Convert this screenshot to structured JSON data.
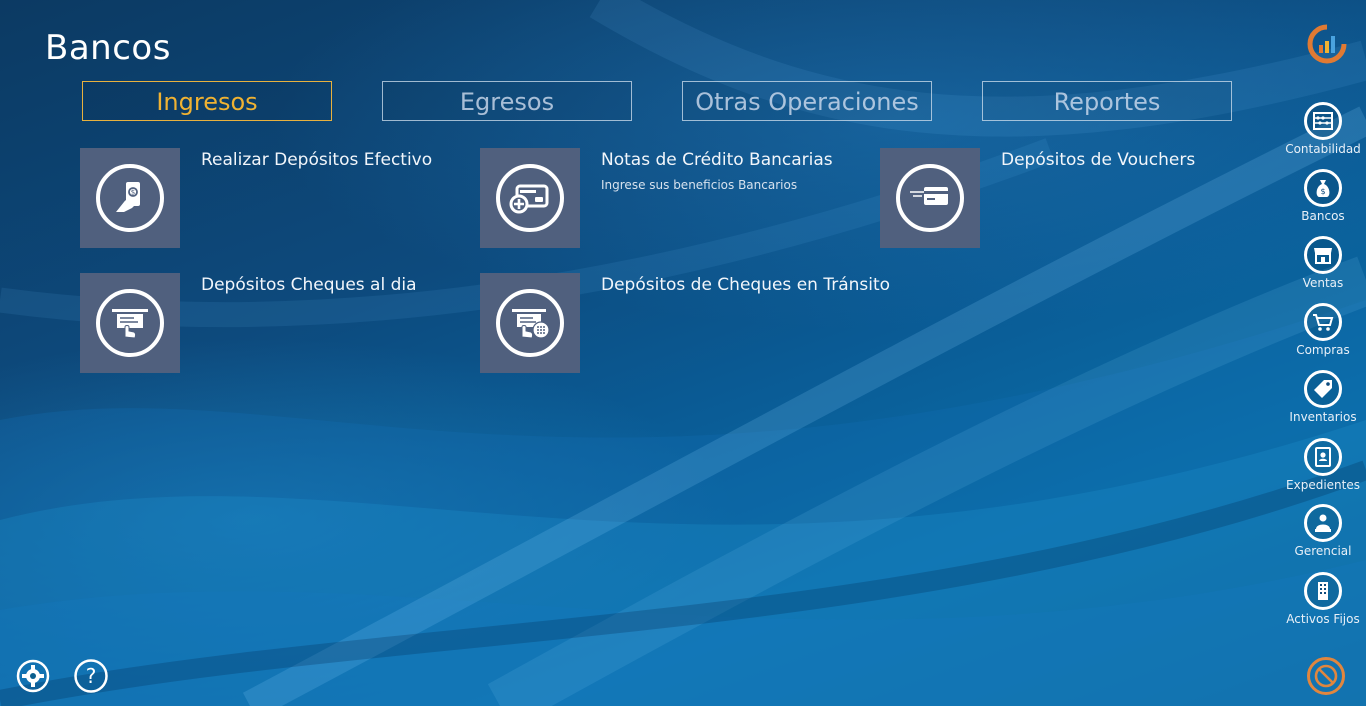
{
  "page_title": "Bancos",
  "tabs": [
    {
      "label": "Ingresos",
      "active": true
    },
    {
      "label": "Egresos",
      "active": false
    },
    {
      "label": "Otras Operaciones",
      "active": false
    },
    {
      "label": "Reportes",
      "active": false
    }
  ],
  "tiles": [
    {
      "title": "Realizar Depósitos Efectivo",
      "subtitle": "",
      "icon": "cash-hand-icon"
    },
    {
      "title": "Notas de Crédito Bancarias",
      "subtitle": "Ingrese sus beneficios Bancarios",
      "icon": "credit-card-plus-icon"
    },
    {
      "title": "Depósitos de Vouchers",
      "subtitle": "",
      "icon": "voucher-card-icon"
    },
    {
      "title": "Depósitos Cheques al dia",
      "subtitle": "",
      "icon": "check-deposit-icon"
    },
    {
      "title": "Depósitos de Cheques en Tránsito",
      "subtitle": "",
      "icon": "check-transit-icon"
    }
  ],
  "sidebar": [
    {
      "label": "Contabilidad",
      "icon": "abacus-icon"
    },
    {
      "label": "Bancos",
      "icon": "money-bag-icon"
    },
    {
      "label": "Ventas",
      "icon": "store-icon"
    },
    {
      "label": "Compras",
      "icon": "cart-icon"
    },
    {
      "label": "Inventarios",
      "icon": "tag-icon"
    },
    {
      "label": "Expedientes",
      "icon": "id-badge-icon"
    },
    {
      "label": "Gerencial",
      "icon": "manager-icon"
    },
    {
      "label": "Activos Fijos",
      "icon": "building-icon"
    }
  ],
  "icons": {
    "logo": "app-logo-icon",
    "settings": "gear-icon",
    "help": "help-icon",
    "exit": "no-entry-icon"
  },
  "colors": {
    "accent": "#f0b232",
    "tile_bg": "#50607e",
    "exit": "#e0863e"
  }
}
